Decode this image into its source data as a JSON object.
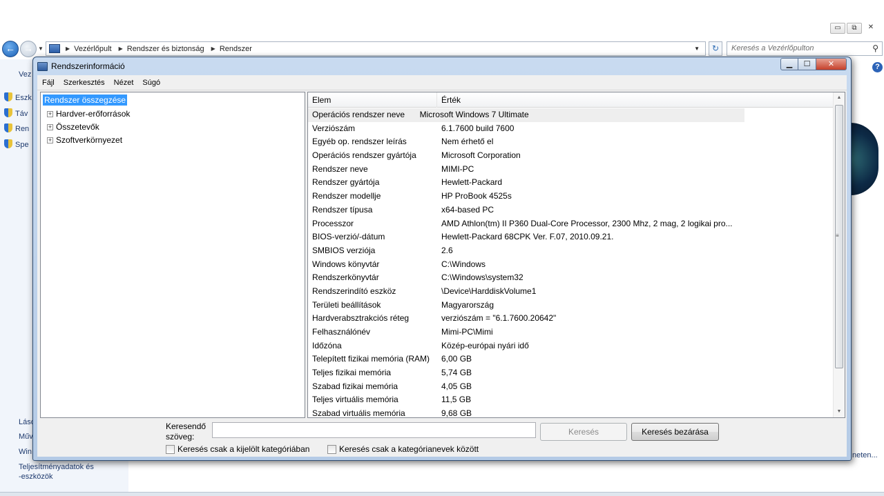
{
  "control_panel": {
    "breadcrumb": [
      "Vezérlőpult",
      "Rendszer és biztonság",
      "Rendszer"
    ],
    "search_placeholder": "Keresés a Vezérlőpulton",
    "caption_buttons": {
      "minimize": "▭",
      "restore": "⧉",
      "close": "✕"
    },
    "left_items": [
      "Eszk",
      "Táv",
      "Ren",
      "Spe"
    ],
    "left_top": "Vez",
    "left_bottom": [
      "Láso",
      "Műv",
      "Win"
    ],
    "perf_link_line1": "Teljesítményadatok és",
    "perf_link_line2": "-eszközök",
    "more_link": "neten..."
  },
  "dialog": {
    "title": "Rendszerinformáció",
    "menu": [
      "Fájl",
      "Szerkesztés",
      "Nézet",
      "Súgó"
    ],
    "tree": {
      "selected": "Rendszer összegzése",
      "nodes": [
        "Hardver-erőforrások",
        "Összetevők",
        "Szoftverkörnyezet"
      ]
    },
    "table": {
      "headers": [
        "Elem",
        "Érték"
      ],
      "rows": [
        [
          "Operációs rendszer neve",
          "Microsoft Windows 7 Ultimate"
        ],
        [
          "Verziószám",
          "6.1.7600 build 7600"
        ],
        [
          "Egyéb op. rendszer leírás",
          "Nem érhető el"
        ],
        [
          "Operációs rendszer gyártója",
          "Microsoft Corporation"
        ],
        [
          "Rendszer neve",
          "MIMI-PC"
        ],
        [
          "Rendszer gyártója",
          "Hewlett-Packard"
        ],
        [
          "Rendszer modellje",
          "HP ProBook 4525s"
        ],
        [
          "Rendszer típusa",
          "x64-based PC"
        ],
        [
          "Processzor",
          "AMD Athlon(tm) II P360 Dual-Core Processor, 2300 Mhz, 2 mag, 2 logikai pro..."
        ],
        [
          "BIOS-verzió/-dátum",
          "Hewlett-Packard 68CPK Ver. F.07, 2010.09.21."
        ],
        [
          "SMBIOS verziója",
          "2.6"
        ],
        [
          "Windows könyvtár",
          "C:\\Windows"
        ],
        [
          "Rendszerkönyvtár",
          "C:\\Windows\\system32"
        ],
        [
          "Rendszerindító eszköz",
          "\\Device\\HarddiskVolume1"
        ],
        [
          "Területi beállítások",
          "Magyarország"
        ],
        [
          "Hardverabsztrakciós réteg",
          "verziószám = \"6.1.7600.20642\""
        ],
        [
          "Felhasználónév",
          "Mimi-PC\\Mimi"
        ],
        [
          "Időzóna",
          "Közép-európai nyári idő"
        ],
        [
          "Telepített fizikai memória (RAM)",
          "6,00 GB"
        ],
        [
          "Teljes fizikai memória",
          "5,74 GB"
        ],
        [
          "Szabad fizikai memória",
          "4,05 GB"
        ],
        [
          "Teljes virtuális memória",
          "11,5 GB"
        ],
        [
          "Szabad virtuális memória",
          "9,68 GB"
        ]
      ]
    },
    "search": {
      "label_line1": "Keresendő",
      "label_line2": "szöveg:",
      "value": "",
      "search_button": "Keresés",
      "close_button": "Keresés bezárása",
      "check_selected_category": "Keresés csak a kijelölt kategóriában",
      "check_category_names": "Keresés csak a kategórianevek között"
    }
  }
}
